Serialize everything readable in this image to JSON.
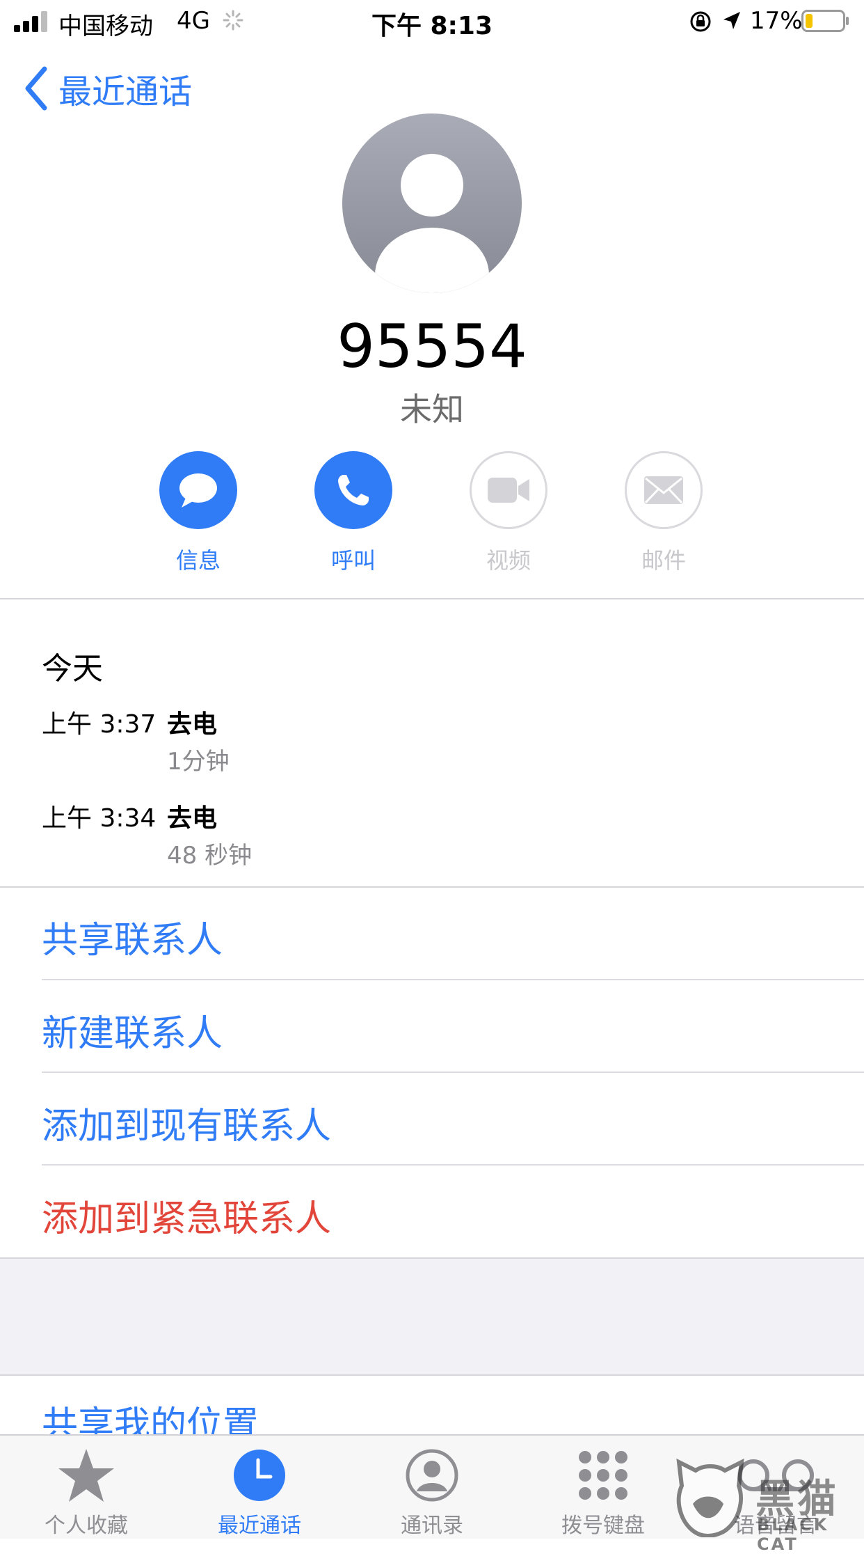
{
  "status_bar": {
    "carrier": "中国移动",
    "network": "4G",
    "time": "下午 8:13",
    "battery_percent": "17%"
  },
  "nav": {
    "back_label": "最近通话"
  },
  "contact": {
    "number": "95554",
    "label": "未知"
  },
  "actions": [
    {
      "label": "信息",
      "icon": "message-icon",
      "enabled": true
    },
    {
      "label": "呼叫",
      "icon": "phone-icon",
      "enabled": true
    },
    {
      "label": "视频",
      "icon": "video-icon",
      "enabled": false
    },
    {
      "label": "邮件",
      "icon": "mail-icon",
      "enabled": false
    }
  ],
  "history": {
    "title": "今天",
    "entries": [
      {
        "time": "上午 3:37",
        "type": "去电",
        "duration": "1分钟"
      },
      {
        "time": "上午 3:34",
        "type": "去电",
        "duration": "48 秒钟"
      }
    ]
  },
  "menu": {
    "share_contact": "共享联系人",
    "new_contact": "新建联系人",
    "add_existing": "添加到现有联系人",
    "add_emergency": "添加到紧急联系人",
    "share_location": "共享我的位置"
  },
  "tabs": [
    {
      "label": "个人收藏",
      "icon": "star-icon",
      "active": false
    },
    {
      "label": "最近通话",
      "icon": "clock-icon",
      "active": true
    },
    {
      "label": "通讯录",
      "icon": "contacts-icon",
      "active": false
    },
    {
      "label": "拨号键盘",
      "icon": "keypad-icon",
      "active": false
    },
    {
      "label": "语音留言",
      "icon": "voicemail-icon",
      "active": false
    }
  ],
  "watermark": {
    "text": "黑猫",
    "sub": "BLACK CAT"
  },
  "colors": {
    "accent": "#2f7cf6",
    "danger": "#e2463a",
    "disabled": "#c8c8cc"
  }
}
